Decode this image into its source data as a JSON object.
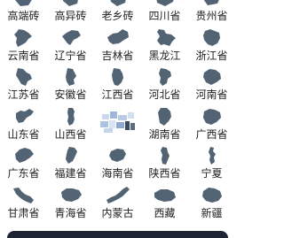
{
  "accent_color": "#526474",
  "provinces": [
    {
      "label": "高端砖",
      "icon": "province-map-icon"
    },
    {
      "label": "高异砖",
      "icon": "province-map-icon"
    },
    {
      "label": "老乡砖",
      "icon": "province-map-icon"
    },
    {
      "label": "四川省",
      "icon": "province-map-icon"
    },
    {
      "label": "贵州省",
      "icon": "province-map-icon"
    },
    {
      "label": "云南省",
      "icon": "yunnan-map-icon"
    },
    {
      "label": "辽宁省",
      "icon": "liaoning-map-icon"
    },
    {
      "label": "吉林省",
      "icon": "jilin-map-icon"
    },
    {
      "label": "黑龙江",
      "icon": "heilongjiang-map-icon"
    },
    {
      "label": "浙江省",
      "icon": "zhejiang-map-icon"
    },
    {
      "label": "江苏省",
      "icon": "jiangsu-map-icon"
    },
    {
      "label": "安徽省",
      "icon": "anhui-map-icon"
    },
    {
      "label": "江西省",
      "icon": "jiangxi-map-icon"
    },
    {
      "label": "河北省",
      "icon": "hebei-map-icon"
    },
    {
      "label": "河南省",
      "icon": "henan-map-icon"
    },
    {
      "label": "山东省",
      "icon": "shandong-map-icon"
    },
    {
      "label": "山西省",
      "icon": "shanxi-map-icon"
    },
    {
      "label": "",
      "icon": "blurred-watermark"
    },
    {
      "label": "湖南省",
      "icon": "hunan-map-icon"
    },
    {
      "label": "广西省",
      "icon": "guangxi-map-icon"
    },
    {
      "label": "广东省",
      "icon": "guangdong-map-icon"
    },
    {
      "label": "福建省",
      "icon": "fujian-map-icon"
    },
    {
      "label": "海南省",
      "icon": "hainan-map-icon"
    },
    {
      "label": "陕西省",
      "icon": "shaanxi-map-icon"
    },
    {
      "label": "宁夏",
      "icon": "ningxia-map-icon"
    },
    {
      "label": "甘肃省",
      "icon": "gansu-map-icon"
    },
    {
      "label": "青海省",
      "icon": "qinghai-map-icon"
    },
    {
      "label": "内蒙古",
      "icon": "neimenggu-map-icon"
    },
    {
      "label": "西藏",
      "icon": "xizang-map-icon"
    },
    {
      "label": "新疆",
      "icon": "xinjiang-map-icon"
    }
  ]
}
